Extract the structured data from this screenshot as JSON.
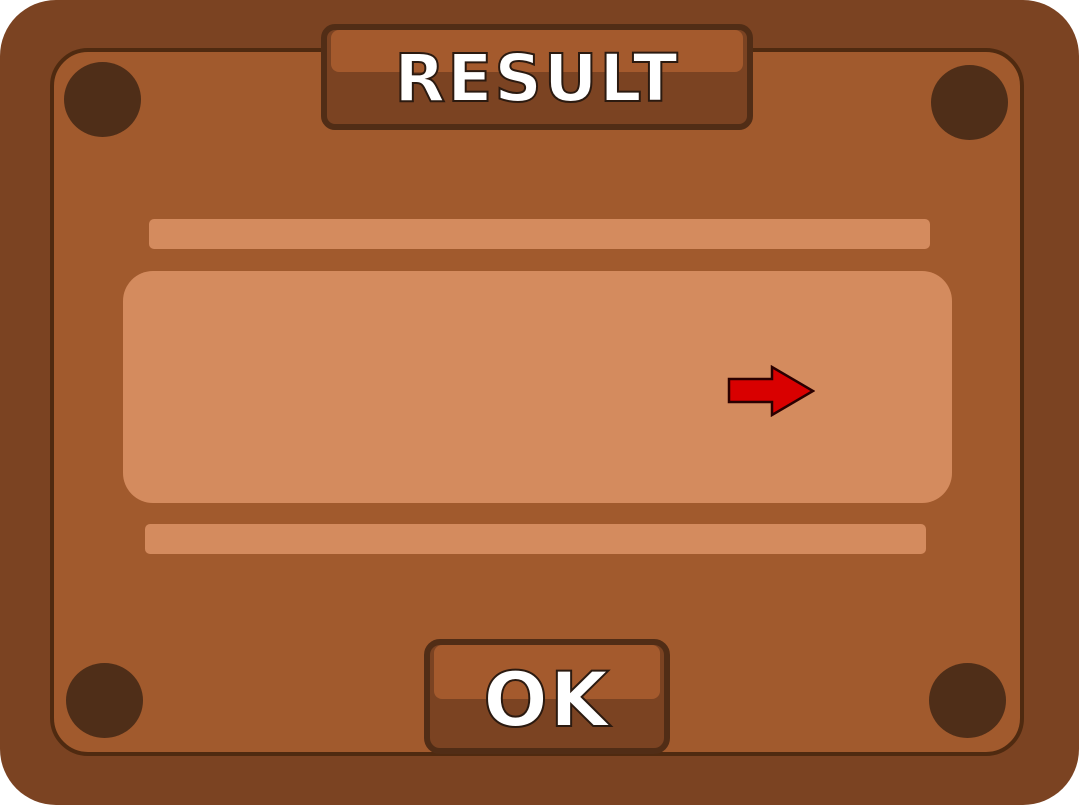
{
  "dialog": {
    "title": "RESULT",
    "ok_label": "OK"
  },
  "icons": {
    "arrow": "red-right-arrow-icon",
    "bolts": "bolt-icon"
  },
  "colors": {
    "frame": "#7b4322",
    "board": "#a15a2d",
    "panel": "#d48b5e",
    "bolt": "#4f2e18",
    "arrow": "#d90000"
  }
}
